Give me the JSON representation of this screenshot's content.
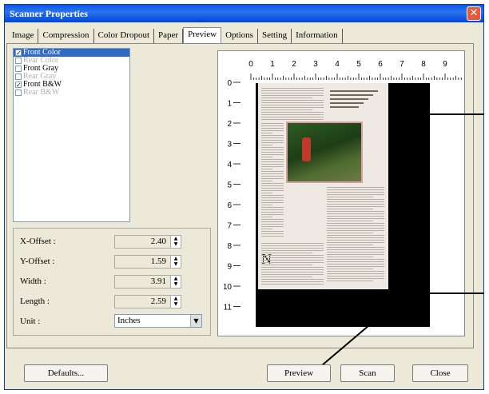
{
  "window": {
    "title": "Scanner Properties"
  },
  "tabs": [
    "Image",
    "Compression",
    "Color Dropout",
    "Paper",
    "Preview",
    "Options",
    "Setting",
    "Information"
  ],
  "active_tab": "Preview",
  "image_list": [
    {
      "label": "Front Color",
      "checked": true,
      "selected": true,
      "enabled": true
    },
    {
      "label": "Rear Color",
      "checked": false,
      "selected": false,
      "enabled": false
    },
    {
      "label": "Front Gray",
      "checked": false,
      "selected": false,
      "enabled": true
    },
    {
      "label": "Rear Gray",
      "checked": false,
      "selected": false,
      "enabled": false
    },
    {
      "label": "Front B&W",
      "checked": true,
      "selected": false,
      "enabled": true
    },
    {
      "label": "Rear B&W",
      "checked": false,
      "selected": false,
      "enabled": false
    }
  ],
  "fields": {
    "x_offset": {
      "label": "X-Offset :",
      "value": "2.40"
    },
    "y_offset": {
      "label": "Y-Offset :",
      "value": "1.59"
    },
    "width": {
      "label": "Width :",
      "value": "3.91"
    },
    "length": {
      "label": "Length :",
      "value": "2.59"
    },
    "unit": {
      "label": "Unit :",
      "value": "Inches"
    }
  },
  "ruler": {
    "top": [
      "0",
      "1",
      "2",
      "3",
      "4",
      "5",
      "6",
      "7",
      "8",
      "9"
    ],
    "left": [
      "0",
      "1",
      "2",
      "3",
      "4",
      "5",
      "6",
      "7",
      "8",
      "9",
      "10",
      "11"
    ]
  },
  "page_dropcap": "N",
  "buttons": {
    "defaults": "Defaults...",
    "preview": "Preview",
    "scan": "Scan",
    "close": "Close"
  },
  "colors": {
    "titlebar": "#0a58e6",
    "selection": "#316ac5",
    "scan_area": "#000000"
  }
}
